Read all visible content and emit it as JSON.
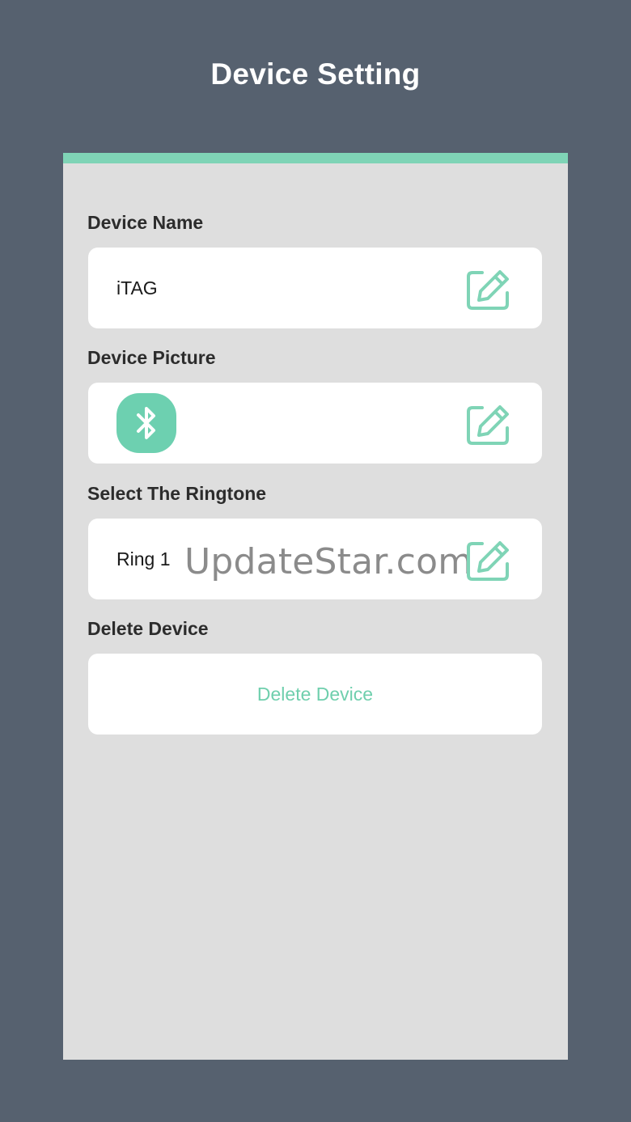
{
  "header": {
    "title": "Device Setting"
  },
  "theme": {
    "accent": "#7fd4b6",
    "background": "#56616f",
    "panel": "#dedede"
  },
  "device_name": {
    "label": "Device Name",
    "value": "iTAG",
    "edit_icon": "edit-icon"
  },
  "device_picture": {
    "label": "Device Picture",
    "picture_icon": "bluetooth-icon",
    "edit_icon": "edit-icon"
  },
  "ringtone": {
    "label": "Select The Ringtone",
    "value": "Ring 1",
    "edit_icon": "edit-icon"
  },
  "delete_section": {
    "label": "Delete Device",
    "button_label": "Delete Device"
  },
  "watermark": {
    "text": "UpdateStar.com"
  }
}
